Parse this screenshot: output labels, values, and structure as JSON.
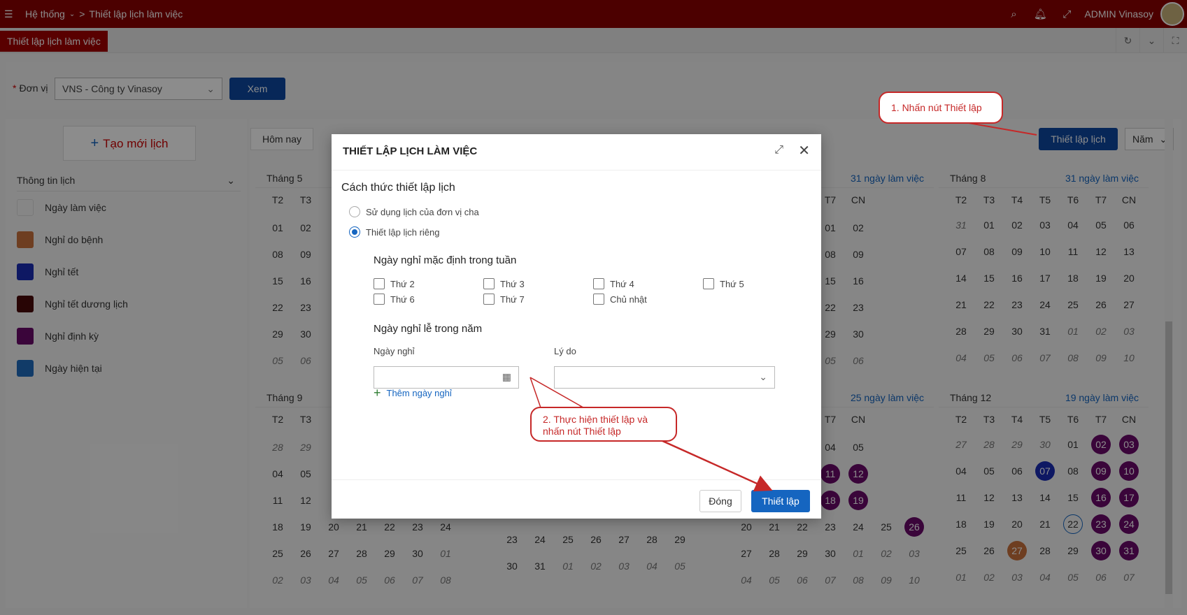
{
  "topbar": {
    "breadcrumb": [
      "Hệ thống",
      "Thiết lập lịch làm việc"
    ],
    "user": "ADMIN Vinasoy",
    "icons": [
      "search-icon",
      "bell-icon",
      "fullscreen-icon"
    ]
  },
  "tab": {
    "title": "Thiết lập lịch làm việc"
  },
  "filter": {
    "label": "Đơn vị",
    "value": "VNS - Công ty Vinasoy",
    "view_button": "Xem"
  },
  "left": {
    "new_button": "Tạo mới lịch",
    "info_title": "Thông tin lịch",
    "legend": [
      {
        "label": "Ngày làm việc",
        "color": "#f5f5f5"
      },
      {
        "label": "Nghỉ do bệnh",
        "color": "#c8713c"
      },
      {
        "label": "Nghỉ tết",
        "color": "#1a2db5"
      },
      {
        "label": "Nghỉ tết dương lịch",
        "color": "#4a0a0a"
      },
      {
        "label": "Nghỉ định kỳ",
        "color": "#6a0a6a"
      },
      {
        "label": "Ngày hiện tại",
        "color": "#1f6cbd"
      }
    ]
  },
  "toolbar": {
    "today": "Hôm nay",
    "setup": "Thiết lập lịch",
    "period": "Năm"
  },
  "weekdays": [
    "T2",
    "T3",
    "T4",
    "T5",
    "T6",
    "T7",
    "CN"
  ],
  "months": [
    {
      "title": "Tháng 5",
      "count": "",
      "rows": [
        [
          "01",
          "02"
        ],
        [
          "08",
          "09"
        ],
        [
          "15",
          "16"
        ],
        [
          "22",
          "23"
        ],
        [
          "29",
          "30"
        ],
        [
          "05",
          "06"
        ]
      ]
    },
    {
      "title": "",
      "count": "31 ngày làm việc",
      "rows": [
        [
          "30",
          "01",
          "02"
        ],
        [
          "07",
          "08",
          "09"
        ],
        [
          "14",
          "15",
          "16"
        ],
        [
          "21",
          "22",
          "23"
        ],
        [
          "28",
          "29",
          "30"
        ],
        [
          "04",
          "05",
          "06"
        ]
      ]
    },
    {
      "title": "Tháng 8",
      "count": "31 ngày làm việc"
    },
    {
      "title": "Tháng 9",
      "count": ""
    },
    {
      "title": "",
      "count": "25 ngày làm việc"
    },
    {
      "title": "Tháng 12",
      "count": "19 ngày làm việc"
    }
  ],
  "modal": {
    "title": "THIẾT LẬP LỊCH LÀM VIỆC",
    "method_title": "Cách thức thiết lập lịch",
    "option1": "Sử dụng lịch của đơn vị cha",
    "option2": "Thiết lập lịch riêng",
    "weekly_title": "Ngày nghỉ mặc định trong tuần",
    "days": [
      "Thứ 2",
      "Thứ 3",
      "Thứ 4",
      "Thứ 5",
      "Thứ 6",
      "Thứ 7",
      "Chủ nhật"
    ],
    "holiday_title": "Ngày nghỉ lễ trong năm",
    "date_label": "Ngày nghỉ",
    "reason_label": "Lý do",
    "add_day": "Thêm ngày nghỉ",
    "close_button": "Đóng",
    "apply_button": "Thiết lập"
  },
  "callouts": {
    "one": "1. Nhấn nút Thiết lập",
    "two_line1": "2. Thực hiện thiết lập và",
    "two_line2": "nhấn nút Thiết lập"
  }
}
